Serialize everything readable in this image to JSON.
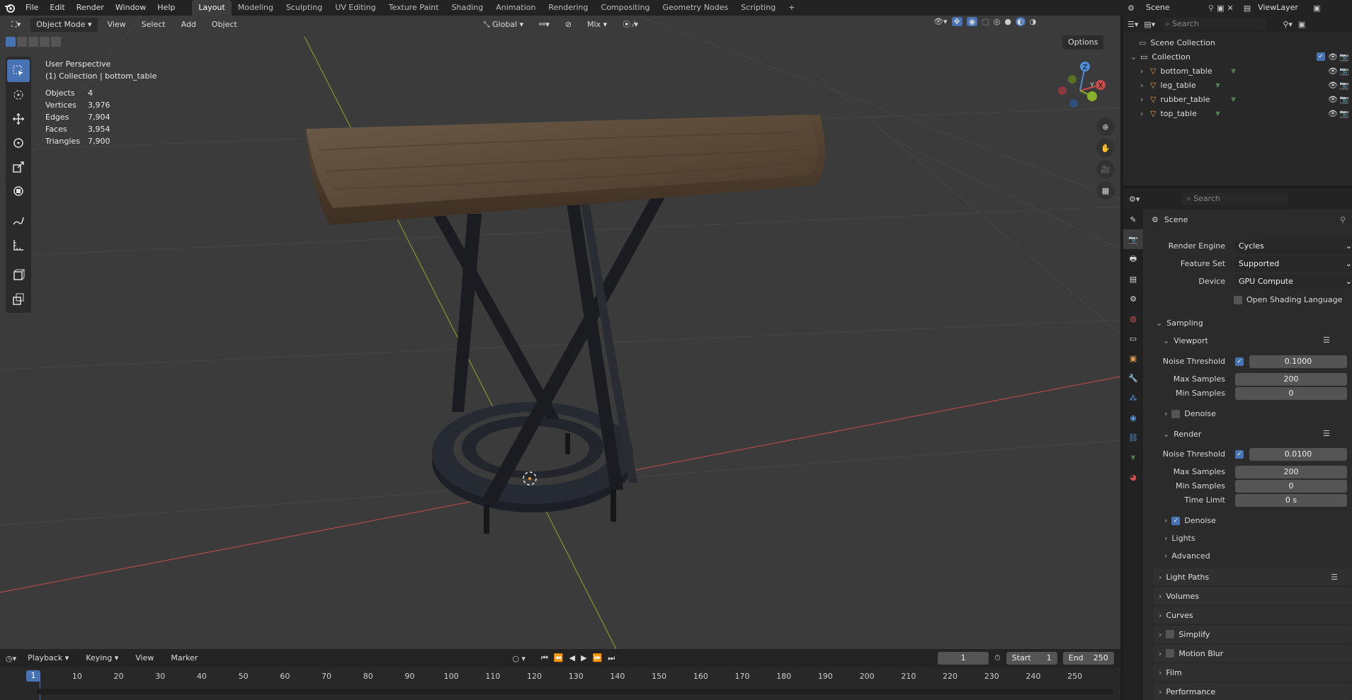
{
  "topbar": {
    "menus": [
      "File",
      "Edit",
      "Render",
      "Window",
      "Help"
    ],
    "workspaces": [
      "Layout",
      "Modeling",
      "Sculpting",
      "UV Editing",
      "Texture Paint",
      "Shading",
      "Animation",
      "Rendering",
      "Compositing",
      "Geometry Nodes",
      "Scripting"
    ],
    "active_workspace": "Layout",
    "add_tab": "+",
    "scene": "Scene",
    "view_layer": "ViewLayer"
  },
  "viewport_header": {
    "mode": "Object Mode",
    "menus": [
      "View",
      "Select",
      "Add",
      "Object"
    ],
    "transform_orientation": "Global",
    "snap_mode": "Mix",
    "options": "Options"
  },
  "overlay": {
    "view_name": "User Perspective",
    "collection_info": "(1) Collection | bottom_table",
    "stats": [
      {
        "k": "Objects",
        "v": "4"
      },
      {
        "k": "Vertices",
        "v": "3,976"
      },
      {
        "k": "Edges",
        "v": "7,904"
      },
      {
        "k": "Faces",
        "v": "3,954"
      },
      {
        "k": "Triangles",
        "v": "7,900"
      }
    ]
  },
  "gizmo": {
    "x": "X",
    "y": "Y",
    "z": "Z"
  },
  "outliner": {
    "search_placeholder": "Search",
    "scene_collection": "Scene Collection",
    "collection": "Collection",
    "objects": [
      "bottom_table",
      "leg_table",
      "rubber_table",
      "top_table"
    ]
  },
  "properties": {
    "search_placeholder": "Search",
    "context": "Scene",
    "render_engine_label": "Render Engine",
    "render_engine": "Cycles",
    "feature_set_label": "Feature Set",
    "feature_set": "Supported",
    "device_label": "Device",
    "device": "GPU Compute",
    "osl": "Open Shading Language",
    "sampling": "Sampling",
    "viewport": "Viewport",
    "noise_threshold": "Noise Threshold",
    "vp_noise": "0.1000",
    "max_samples": "Max Samples",
    "vp_max": "200",
    "min_samples": "Min Samples",
    "vp_min": "0",
    "denoise": "Denoise",
    "render": "Render",
    "r_noise": "0.0100",
    "r_max": "200",
    "r_min": "0",
    "time_limit": "Time Limit",
    "r_time": "0 s",
    "lights": "Lights",
    "advanced": "Advanced",
    "light_paths": "Light Paths",
    "volumes": "Volumes",
    "curves": "Curves",
    "simplify": "Simplify",
    "motion_blur": "Motion Blur",
    "film": "Film",
    "performance": "Performance"
  },
  "timeline": {
    "menus": [
      "Playback",
      "Keying",
      "View",
      "Marker"
    ],
    "current_frame": "1",
    "start_label": "Start",
    "start": "1",
    "end_label": "End",
    "end": "250",
    "ticks": [
      "1",
      "10",
      "20",
      "30",
      "40",
      "50",
      "60",
      "70",
      "80",
      "90",
      "100",
      "110",
      "120",
      "130",
      "140",
      "150",
      "160",
      "170",
      "180",
      "190",
      "200",
      "210",
      "220",
      "230",
      "240",
      "250"
    ]
  },
  "colors": {
    "accent": "#4772b3",
    "x_axis": "#c94a4a",
    "y_axis": "#8ab12a",
    "z_axis": "#4b8ed6"
  }
}
